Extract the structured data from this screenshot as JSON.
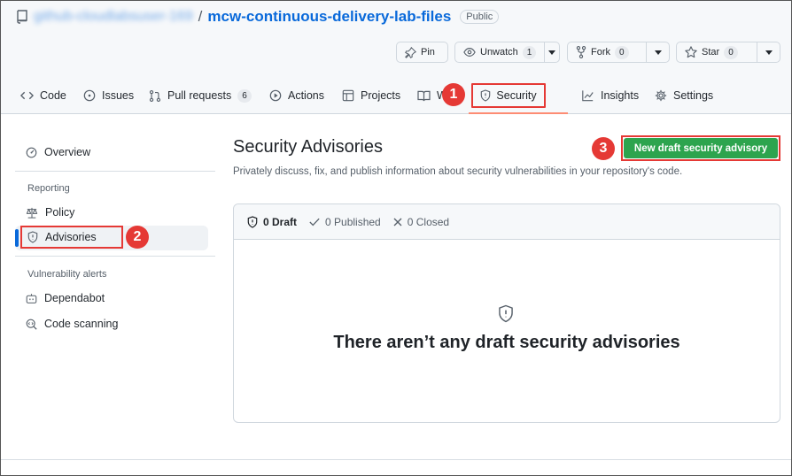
{
  "repo": {
    "owner": "github-cloudlabsuser-169",
    "separator": "/",
    "name": "mcw-continuous-delivery-lab-files",
    "visibility": "Public"
  },
  "actions": {
    "pin": "Pin",
    "watch": {
      "label": "Unwatch",
      "count": "1"
    },
    "fork": {
      "label": "Fork",
      "count": "0"
    },
    "star": {
      "label": "Star",
      "count": "0"
    }
  },
  "tabs": [
    {
      "label": "Code",
      "icon": "code-icon"
    },
    {
      "label": "Issues",
      "icon": "issue-icon"
    },
    {
      "label": "Pull requests",
      "icon": "pull-request-icon",
      "count": "6"
    },
    {
      "label": "Actions",
      "icon": "play-icon"
    },
    {
      "label": "Projects",
      "icon": "table-icon"
    },
    {
      "label": "W",
      "icon": "book-icon"
    },
    {
      "label": "Security",
      "icon": "shield-icon",
      "selected": true
    },
    {
      "label": "Insights",
      "icon": "graph-icon"
    },
    {
      "label": "Settings",
      "icon": "gear-icon"
    }
  ],
  "sidebar": {
    "overview": "Overview",
    "reporting_heading": "Reporting",
    "policy": "Policy",
    "advisories": "Advisories",
    "alerts_heading": "Vulnerability alerts",
    "dependabot": "Dependabot",
    "code_scanning": "Code scanning"
  },
  "main": {
    "title": "Security Advisories",
    "description": "Privately discuss, fix, and publish information about security vulnerabilities in your repository's code.",
    "new_button": "New draft security advisory",
    "filters": {
      "draft": "0 Draft",
      "published": "0 Published",
      "closed": "0 Closed"
    },
    "empty_message": "There aren’t any draft security advisories"
  },
  "callouts": {
    "one": "1",
    "two": "2",
    "three": "3"
  },
  "colors": {
    "accent": "#0969da",
    "primary_button": "#2da44e",
    "callout": "#e53935",
    "tab_underline": "#fd8c73"
  }
}
